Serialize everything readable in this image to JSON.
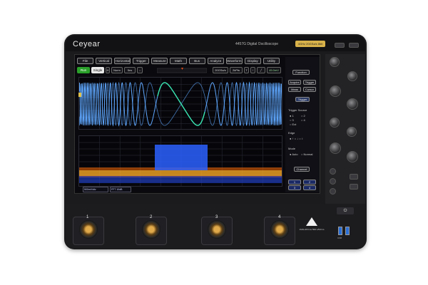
{
  "device": {
    "brand": "Ceyear",
    "model": "4457G Digital Oscilloscope",
    "badge": "4GHz 20GSa/s 8bit"
  },
  "menu": [
    "File",
    "Vertical",
    "Horizontal",
    "Trigger",
    "Measure",
    "Math",
    "Bus",
    "Analyze",
    "Waveform",
    "Display",
    "Utility"
  ],
  "toolbar": {
    "run": "Run",
    "single": "Single",
    "acq_mode": "Norm",
    "time_scale": "5ns",
    "sample_rate": "20GSa/s",
    "record": "2kPts",
    "trig_level": "45.0mV"
  },
  "side_panel": {
    "function": "Function",
    "acquire": "Acquire",
    "trigger": "Trigger",
    "meas": "Meas",
    "cursor": "Cursor",
    "trigger_section": "Trigger",
    "trigger_source": "Trigger Source",
    "sources": [
      "1",
      "2",
      "3",
      "4",
      "Ext"
    ],
    "edge": "Edge",
    "mode": "Mode",
    "modes": [
      "Auto",
      "Normal"
    ],
    "channel": "Channel"
  },
  "channel_boxes": {
    "ch1": "500mV/div",
    "ch2": "FFT 10dB"
  },
  "channels": [
    "1",
    "2",
    "3",
    "4"
  ],
  "power_label": "⏻",
  "warning_text": "1MΩ ≤5Vrms 50Ω ≤5Vrms",
  "usb_label": "USB",
  "colors": {
    "chirp": "#5fa8ff",
    "chirp_center": "#39e6b0",
    "spectrum": "#2b62ff",
    "trace_accent": "#e04a1a"
  }
}
